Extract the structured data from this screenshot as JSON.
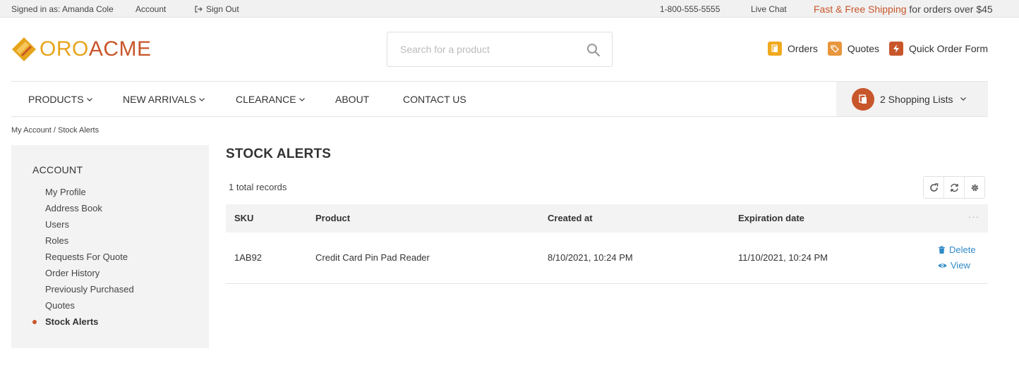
{
  "topbar": {
    "signed_in": "Signed in as: Amanda Cole",
    "account": "Account",
    "sign_out": "Sign Out",
    "phone": "1-800-555-5555",
    "live_chat": "Live Chat",
    "promo_accent": "Fast & Free Shipping",
    "promo_rest": " for orders over $45"
  },
  "logo": {
    "oro": "ORO",
    "acme": "ACME"
  },
  "search": {
    "placeholder": "Search for a product"
  },
  "header_links": [
    {
      "label": "Orders",
      "icon": "orders-icon",
      "color": "#f0a91e"
    },
    {
      "label": "Quotes",
      "icon": "quotes-icon",
      "color": "#e8953c"
    },
    {
      "label": "Quick Order Form",
      "icon": "quick-order-icon",
      "color": "#c8562b"
    }
  ],
  "nav": {
    "products": "PRODUCTS",
    "new_arrivals": "NEW ARRIVALS",
    "clearance": "CLEARANCE",
    "about": "ABOUT",
    "contact": "CONTACT US",
    "shopping_lists": "2 Shopping Lists"
  },
  "breadcrumb": "My Account / Stock Alerts",
  "sidebar": {
    "title": "ACCOUNT",
    "items": [
      {
        "label": "My Profile"
      },
      {
        "label": "Address Book"
      },
      {
        "label": "Users"
      },
      {
        "label": "Roles"
      },
      {
        "label": "Requests For Quote"
      },
      {
        "label": "Order History"
      },
      {
        "label": "Previously Purchased"
      },
      {
        "label": "Quotes"
      },
      {
        "label": "Stock Alerts",
        "active": true
      }
    ]
  },
  "main": {
    "title": "STOCK ALERTS",
    "records": "1 total records",
    "tools": [
      "refresh-icon",
      "reset-icon",
      "settings-icon"
    ]
  },
  "grid": {
    "columns": [
      "SKU",
      "Product",
      "Created at",
      "Expiration date"
    ],
    "more": "···",
    "rows": [
      {
        "sku": "1AB92",
        "product": "Credit Card Pin Pad Reader",
        "created": "8/10/2021, 10:24 PM",
        "expires": "11/10/2021, 10:24 PM",
        "delete": "Delete",
        "view": "View"
      }
    ]
  },
  "colors": {
    "accent": "#c8562b",
    "brand_yellow": "#e6a41d",
    "link": "#2f8ac8"
  }
}
